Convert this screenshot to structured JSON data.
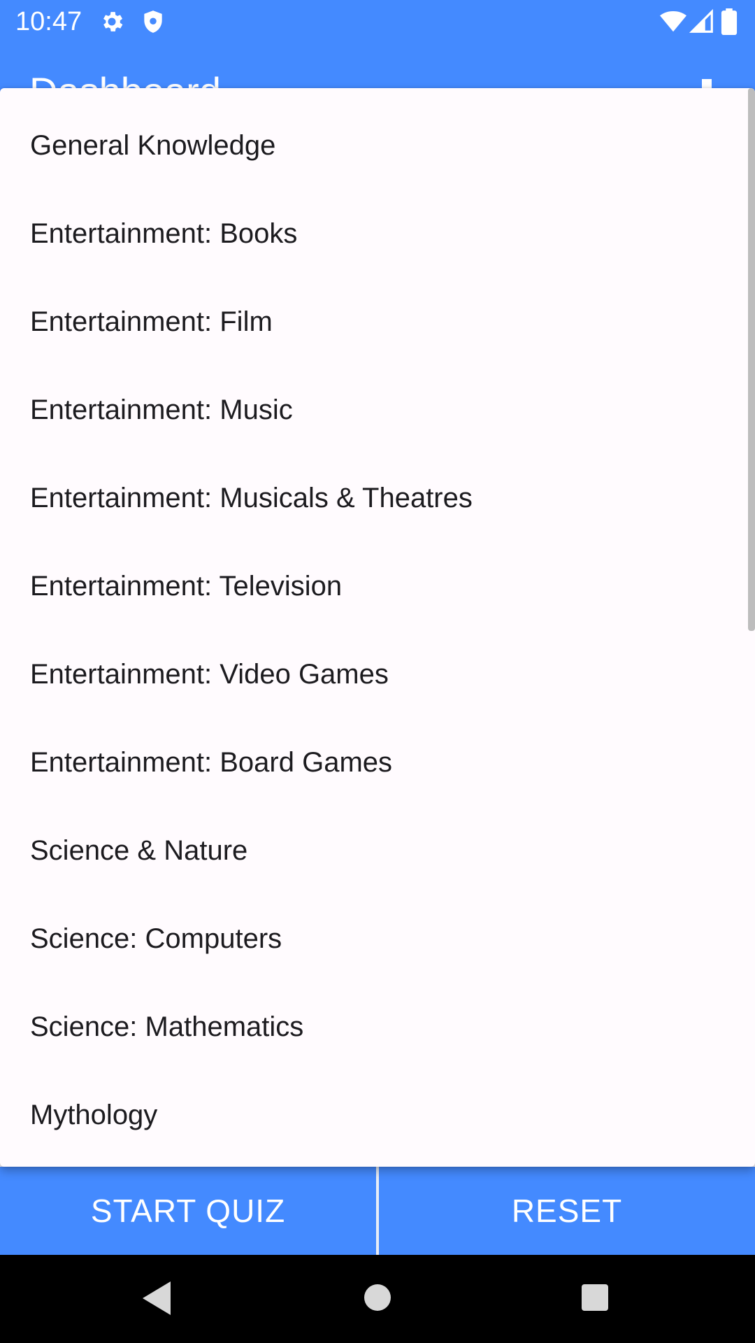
{
  "status_bar": {
    "time": "10:47",
    "icons": [
      "gear-icon",
      "shield-icon",
      "wifi-icon",
      "signal-icon",
      "battery-icon"
    ]
  },
  "app_bar": {
    "title": "Dashboard",
    "menu_icon": "more-vert-icon"
  },
  "dropdown": {
    "items": [
      "General Knowledge",
      "Entertainment: Books",
      "Entertainment: Film",
      "Entertainment: Music",
      "Entertainment: Musicals & Theatres",
      "Entertainment: Television",
      "Entertainment: Video Games",
      "Entertainment: Board Games",
      "Science & Nature",
      "Science: Computers",
      "Science: Mathematics",
      "Mythology"
    ]
  },
  "buttons": {
    "start_quiz": "START QUIZ",
    "reset": "RESET"
  },
  "colors": {
    "primary": "#448aff",
    "menu_background": "#fffbfe",
    "menu_text": "#1c1b1f"
  },
  "nav_bar": {
    "icons": [
      "back-icon",
      "home-icon",
      "recents-icon"
    ]
  }
}
